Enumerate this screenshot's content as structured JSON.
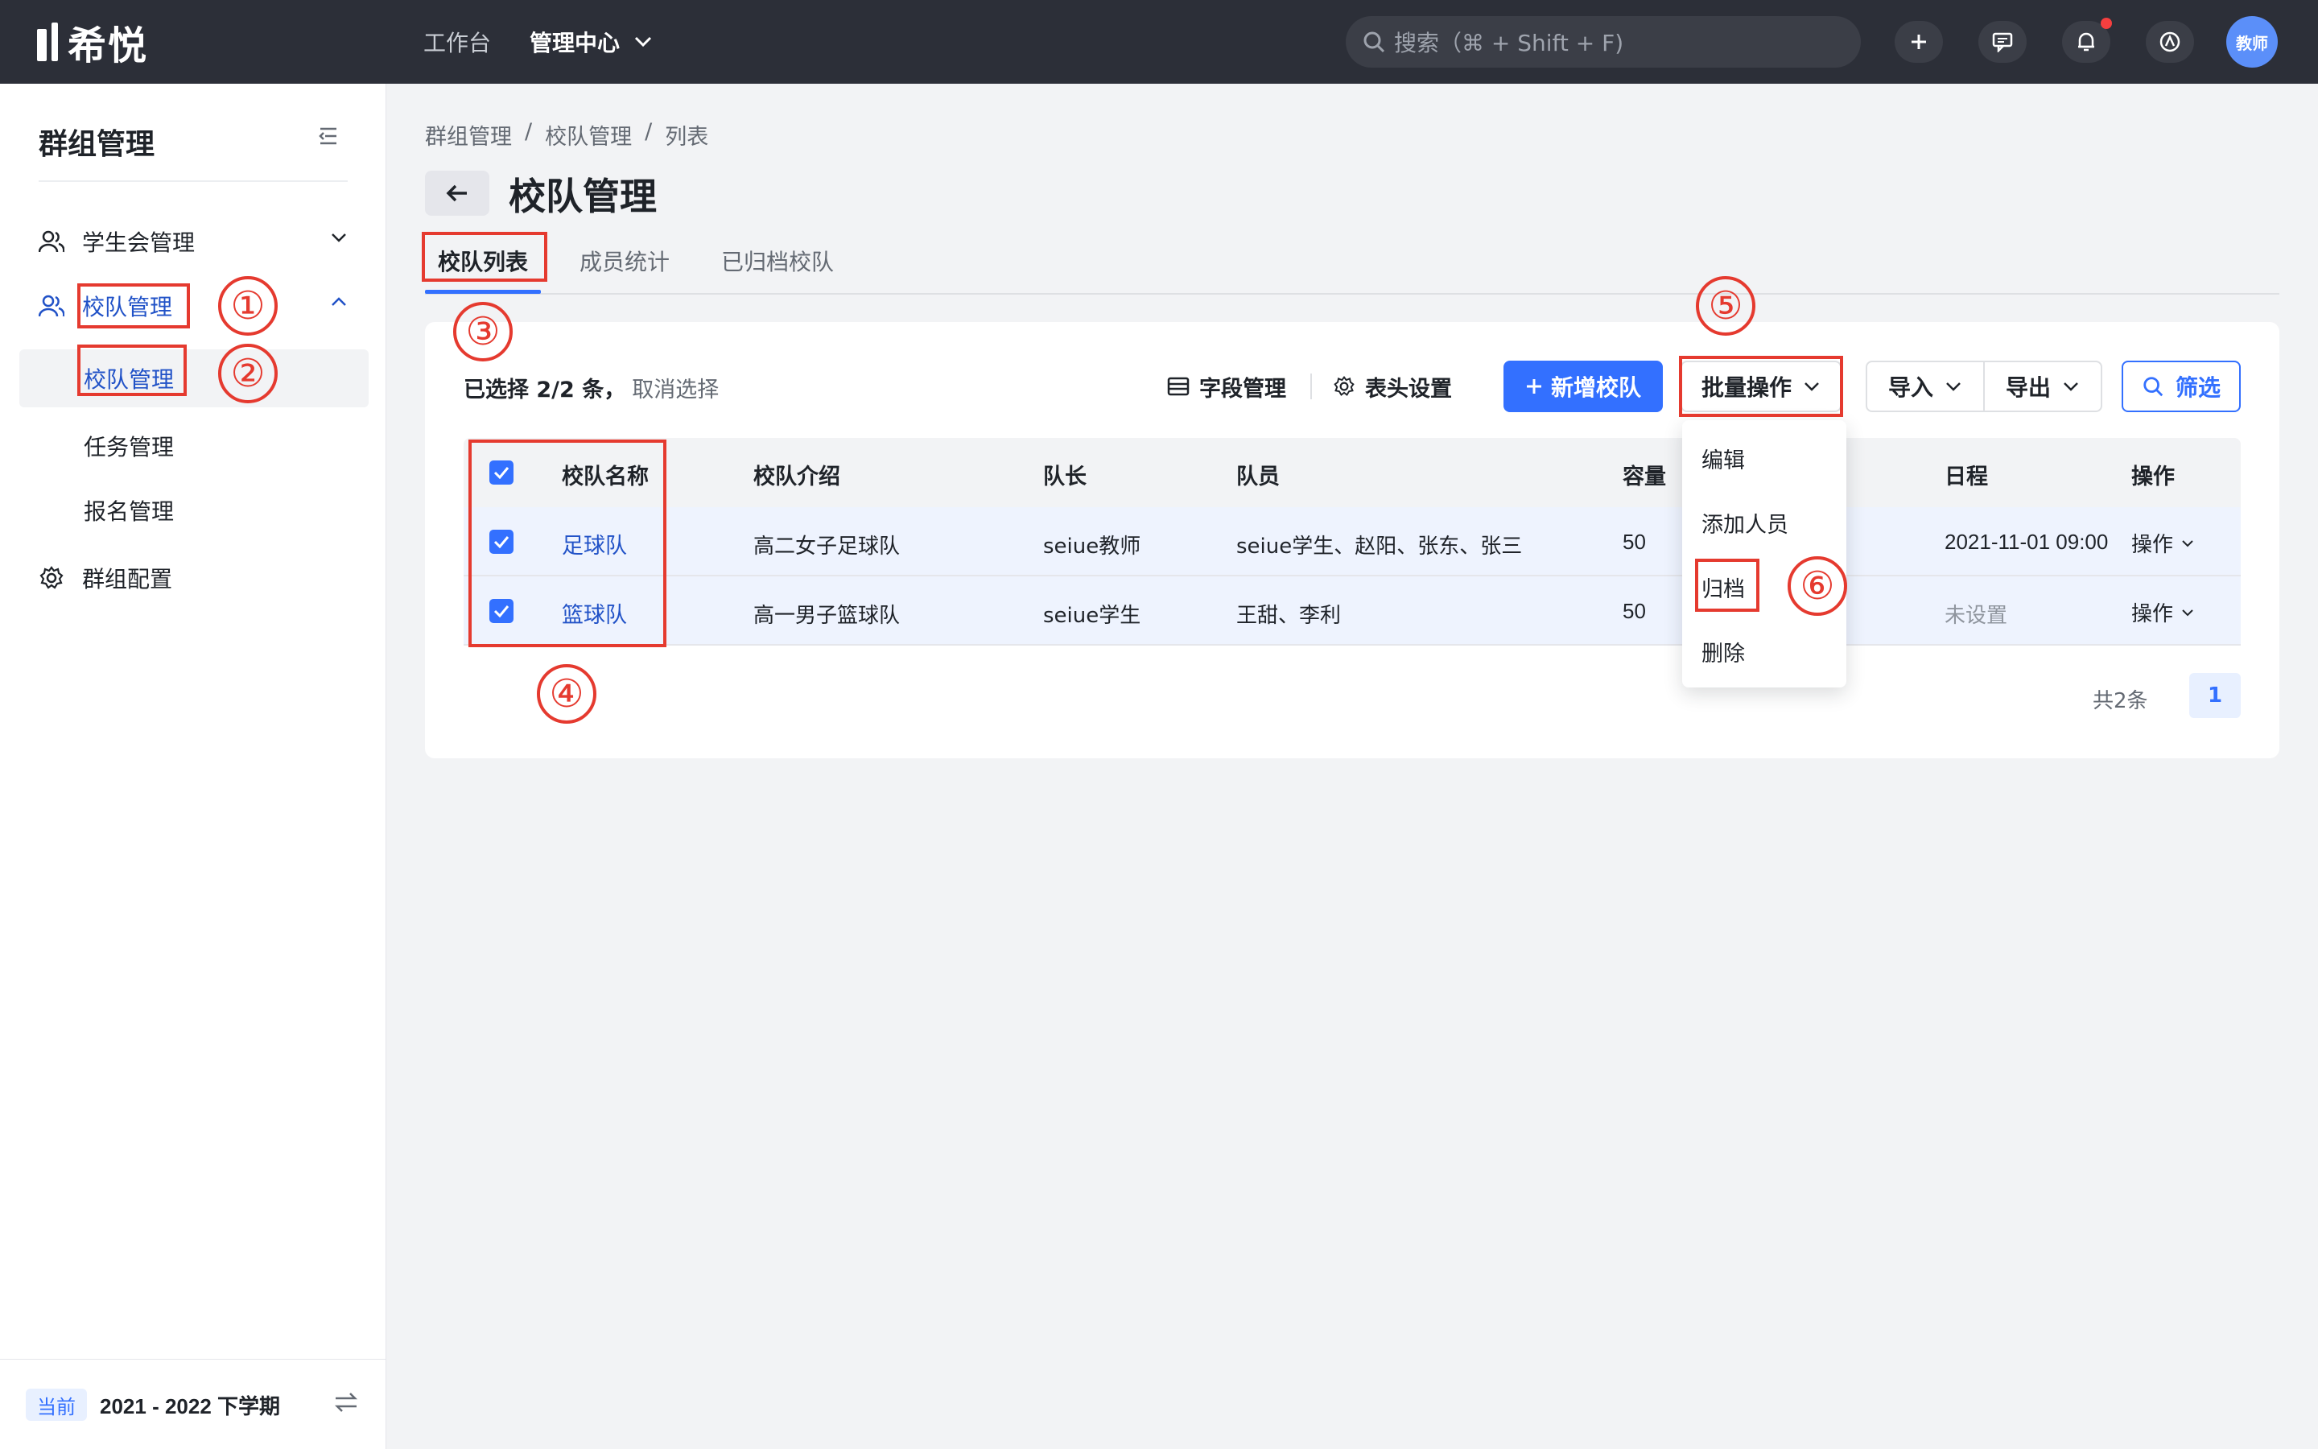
{
  "app": {
    "logo_text": "希悦"
  },
  "topbar": {
    "nav_workbench": "工作台",
    "nav_admin": "管理中心",
    "search_placeholder": "搜索（⌘ + Shift + F)",
    "avatar_text": "教师"
  },
  "sidebar": {
    "title": "群组管理",
    "items": [
      {
        "label": "学生会管理"
      },
      {
        "label": "校队管理"
      },
      {
        "label": "群组配置"
      }
    ],
    "sub_items": [
      {
        "label": "校队管理"
      },
      {
        "label": "任务管理"
      },
      {
        "label": "报名管理"
      }
    ],
    "term_tag": "当前",
    "term_text": "2021 - 2022 下学期"
  },
  "breadcrumb": [
    "群组管理",
    "校队管理",
    "列表"
  ],
  "breadcrumb_sep": "/",
  "page_title": "校队管理",
  "tabs": [
    {
      "label": "校队列表"
    },
    {
      "label": "成员统计"
    },
    {
      "label": "已归档校队"
    }
  ],
  "toolbar": {
    "selected_text": "已选择 2/2 条，",
    "cancel_select": "取消选择",
    "field_manage": "字段管理",
    "header_settings": "表头设置",
    "add_team": "新增校队",
    "batch_ops": "批量操作",
    "import": "导入",
    "export": "导出",
    "filter": "筛选"
  },
  "table": {
    "columns": [
      "校队名称",
      "校队介绍",
      "队长",
      "队员",
      "容量",
      "日程",
      "操作"
    ],
    "rows": [
      {
        "name": "足球队",
        "intro": "高二女子足球队",
        "captain": "seiue教师",
        "members": "seiue学生、赵阳、张东、张三",
        "capacity": "50",
        "schedule": "2021-11-01 09:00",
        "action": "操作"
      },
      {
        "name": "篮球队",
        "intro": "高一男子篮球队",
        "captain": "seiue学生",
        "members": "王甜、李利",
        "capacity": "50",
        "schedule": "未设置",
        "action": "操作"
      }
    ]
  },
  "pagination": {
    "total": "共2条",
    "current": "1"
  },
  "batch_menu": [
    "编辑",
    "添加人员",
    "归档",
    "删除"
  ],
  "annotations": [
    "①",
    "②",
    "③",
    "④",
    "⑤",
    "⑥"
  ],
  "colors": {
    "accent": "#3370ff",
    "topbar": "#2c2f38",
    "annotation": "#e53a2f"
  }
}
